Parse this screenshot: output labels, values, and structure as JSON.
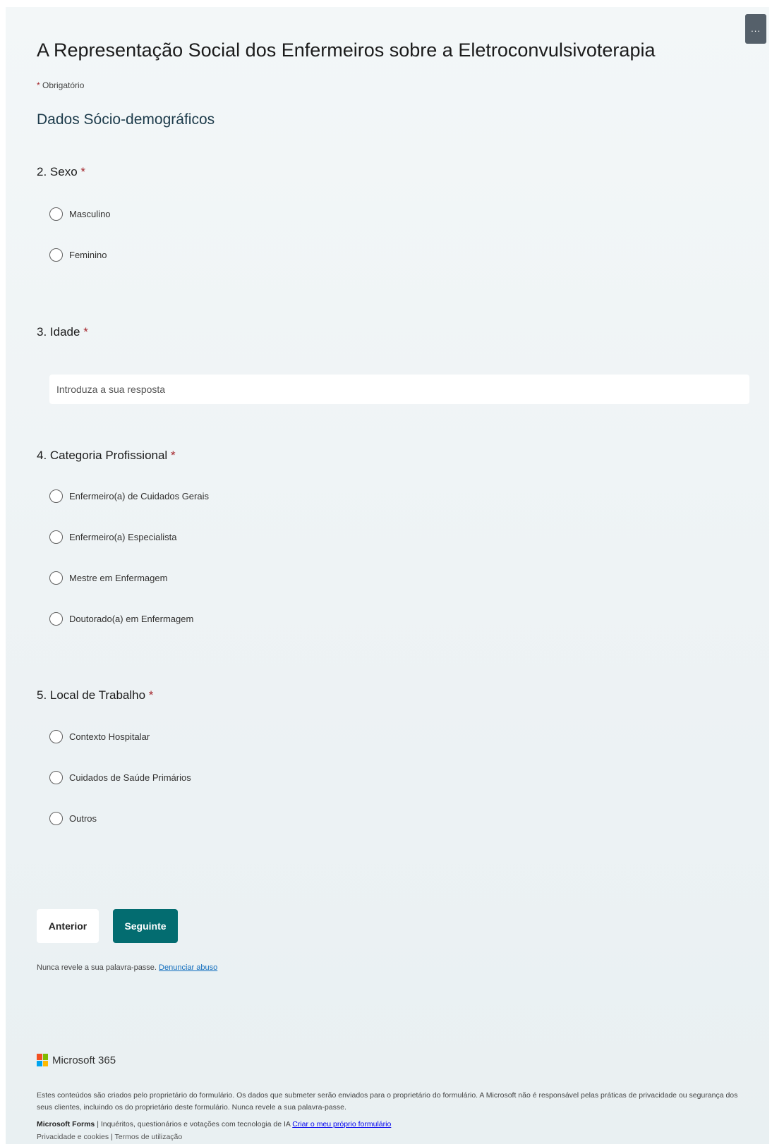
{
  "form": {
    "title": "A Representação Social dos Enfermeiros sobre a Eletroconvulsivoterapia",
    "required_mark": "*",
    "required_note": "Obrigatório",
    "section_title": "Dados Sócio-demográficos",
    "menu_label": "..."
  },
  "questions": [
    {
      "label": "2. Sexo",
      "options": [
        "Masculino",
        "Feminino"
      ]
    },
    {
      "label": "3. Idade",
      "placeholder": "Introduza a sua resposta"
    },
    {
      "label": "4. Categoria Profissional",
      "options": [
        "Enfermeiro(a) de Cuidados Gerais",
        "Enfermeiro(a) Especialista",
        "Mestre em Enfermagem",
        "Doutorado(a) em Enfermagem"
      ]
    },
    {
      "label": "5. Local de Trabalho",
      "options": [
        "Contexto Hospitalar",
        "Cuidados de Saúde Primários",
        "Outros"
      ]
    }
  ],
  "buttons": {
    "back": "Anterior",
    "next": "Seguinte"
  },
  "notice": {
    "text": "Nunca revele a sua palavra-passe.",
    "link": "Denunciar abuso"
  },
  "footer": {
    "brand": "Microsoft 365",
    "disclaimer": "Estes conteúdos são criados pelo proprietário do formulário. Os dados que submeter serão enviados para o proprietário do formulário. A Microsoft não é responsável pelas práticas de privacidade ou segurança dos seus clientes, incluindo os do proprietário deste formulário. Nunca revele a sua palavra-passe.",
    "forms_brand": "Microsoft Forms",
    "forms_text": "| Inquéritos, questionários e votações com tecnologia de IA",
    "create_link": "Criar o meu próprio formulário",
    "privacy_link": "Privacidade e cookies",
    "separator": "|",
    "terms_link": "Termos de utilização"
  },
  "colors": {
    "accent": "#036c70",
    "required": "#a4262c",
    "logo": [
      "#f25022",
      "#7fba00",
      "#00a4ef",
      "#ffb900"
    ]
  }
}
